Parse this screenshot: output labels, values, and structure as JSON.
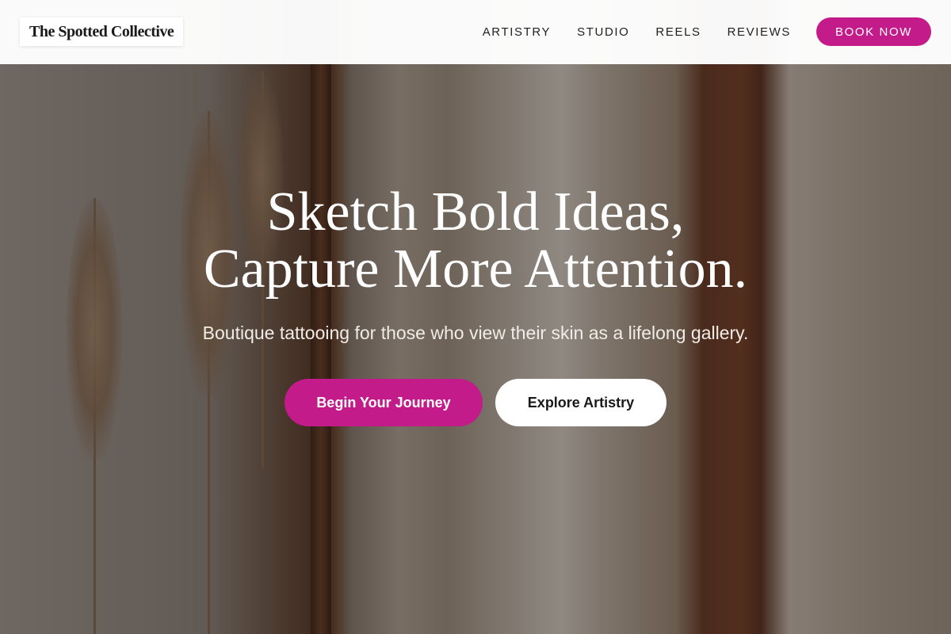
{
  "brand": {
    "name": "The Spotted Collective"
  },
  "nav": {
    "links": [
      "ARTISTRY",
      "STUDIO",
      "REELS",
      "REVIEWS"
    ],
    "cta_label": "BOOK NOW"
  },
  "hero": {
    "title_line_1": "Sketch Bold Ideas,",
    "title_line_2": "Capture More Attention.",
    "subtitle": "Boutique tattooing for those who view their skin as a lifelong gallery.",
    "primary_cta": "Begin Your Journey",
    "secondary_cta": "Explore Artistry",
    "background_image": "clothing-rack-with-pampas-grass-photo"
  },
  "colors": {
    "accent": "#c41b8a",
    "nav_background": "#ffffff",
    "hero_text": "#ffffff",
    "secondary_button": "#ffffff"
  }
}
